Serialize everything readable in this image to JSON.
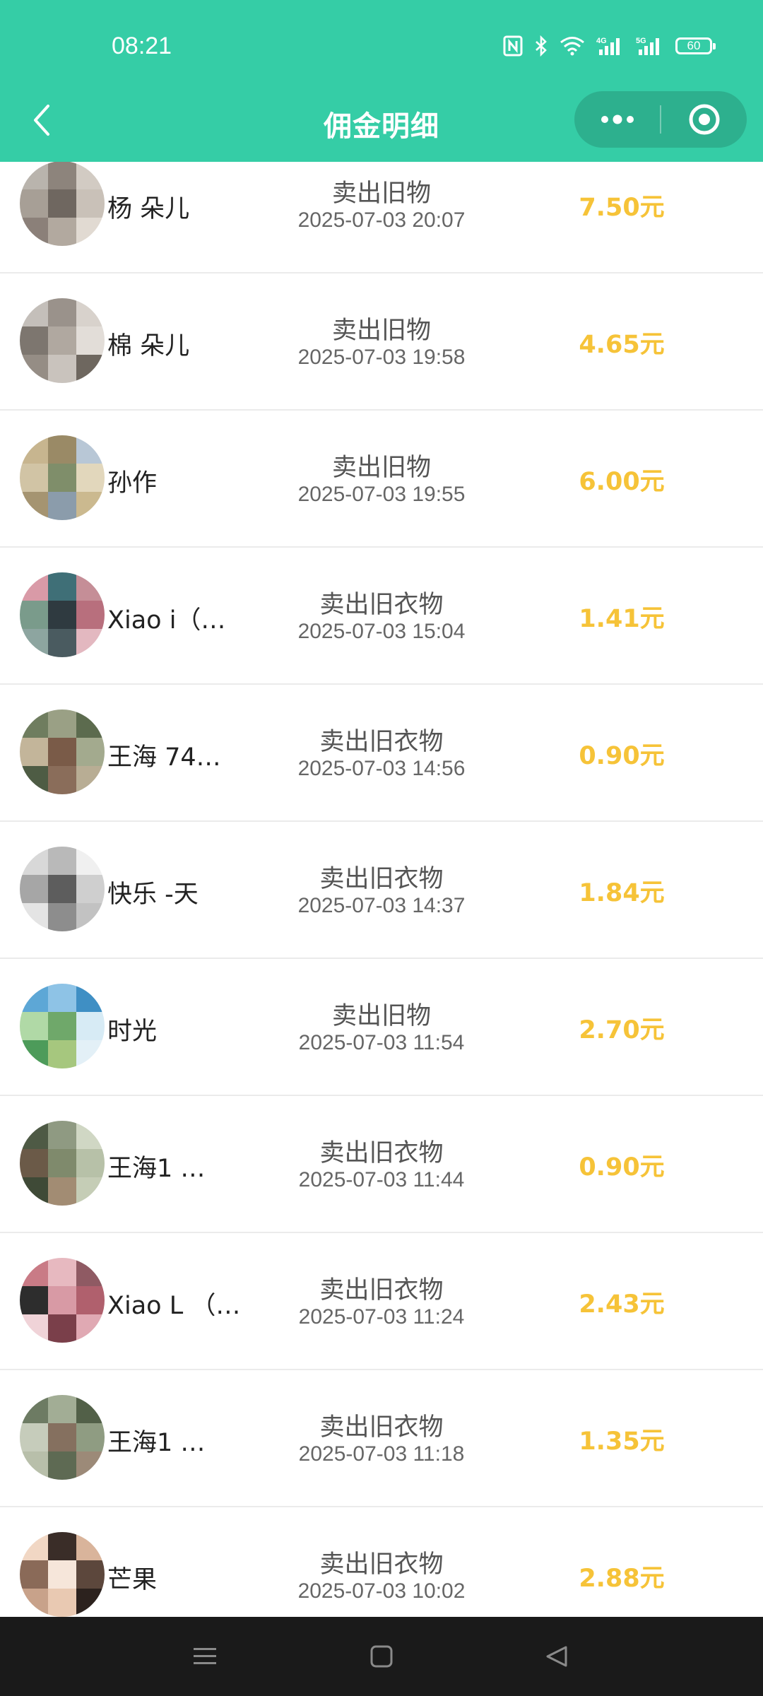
{
  "status_bar": {
    "time": "08:21",
    "battery": "60",
    "icons": [
      "nfc-icon",
      "bluetooth-icon",
      "wifi-icon",
      "signal-4g-icon",
      "signal-5g-icon",
      "battery-icon"
    ]
  },
  "nav": {
    "title": "佣金明细",
    "accent_color": "#35cda6"
  },
  "colors": {
    "amount": "#f6c338",
    "header": "#35cda6",
    "system_nav": "#1a1a1a"
  },
  "records": [
    {
      "name": "杨   朵儿",
      "title": "卖出旧物",
      "time": "2025-07-03 20:07",
      "amount": "7.50元"
    },
    {
      "name": "棉   朵儿",
      "title": "卖出旧物",
      "time": "2025-07-03 19:58",
      "amount": "4.65元"
    },
    {
      "name": "孙作",
      "title": "卖出旧物",
      "time": "2025-07-03 19:55",
      "amount": "6.00元"
    },
    {
      "name": "Xiao   i（…",
      "title": "卖出旧衣物",
      "time": "2025-07-03 15:04",
      "amount": "1.41元"
    },
    {
      "name": "王海   74…",
      "title": "卖出旧衣物",
      "time": "2025-07-03 14:56",
      "amount": "0.90元"
    },
    {
      "name": "快乐   -天",
      "title": "卖出旧衣物",
      "time": "2025-07-03 14:37",
      "amount": "1.84元"
    },
    {
      "name": "时光",
      "title": "卖出旧物",
      "time": "2025-07-03 11:54",
      "amount": "2.70元"
    },
    {
      "name": "王海1   …",
      "title": "卖出旧衣物",
      "time": "2025-07-03 11:44",
      "amount": "0.90元"
    },
    {
      "name": "Xiao L   （…",
      "title": "卖出旧衣物",
      "time": "2025-07-03 11:24",
      "amount": "2.43元"
    },
    {
      "name": "王海1   …",
      "title": "卖出旧衣物",
      "time": "2025-07-03 11:18",
      "amount": "1.35元"
    },
    {
      "name": "芒果",
      "title": "卖出旧衣物",
      "time": "2025-07-03 10:02",
      "amount": "2.88元"
    }
  ]
}
